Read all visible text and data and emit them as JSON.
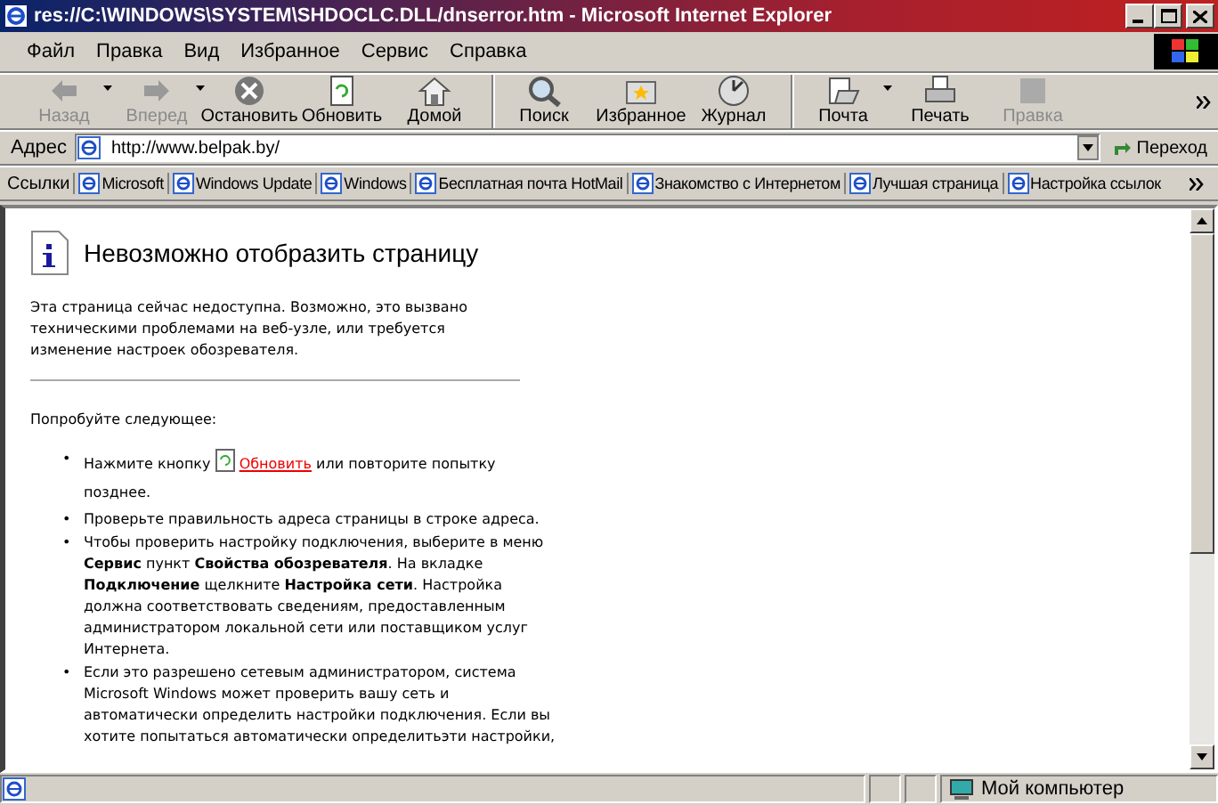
{
  "window": {
    "title": "res://C:\\WINDOWS\\SYSTEM\\SHDOCLC.DLL/dnserror.htm - Microsoft Internet Explorer"
  },
  "menu": [
    "Файл",
    "Правка",
    "Вид",
    "Избранное",
    "Сервис",
    "Справка"
  ],
  "toolbar": [
    {
      "label": "Назад",
      "disabled": true,
      "dropdown": true,
      "separator_before": false
    },
    {
      "label": "Вперед",
      "disabled": true,
      "dropdown": true,
      "separator_before": false
    },
    {
      "label": "Остановить",
      "disabled": false,
      "dropdown": false,
      "separator_before": false
    },
    {
      "label": "Обновить",
      "disabled": false,
      "dropdown": false,
      "separator_before": false
    },
    {
      "label": "Домой",
      "disabled": false,
      "dropdown": false,
      "separator_before": false
    },
    {
      "label": "Поиск",
      "disabled": false,
      "dropdown": false,
      "separator_before": true
    },
    {
      "label": "Избранное",
      "disabled": false,
      "dropdown": false,
      "separator_before": false
    },
    {
      "label": "Журнал",
      "disabled": false,
      "dropdown": false,
      "separator_before": false
    },
    {
      "label": "Почта",
      "disabled": false,
      "dropdown": true,
      "separator_before": true
    },
    {
      "label": "Печать",
      "disabled": false,
      "dropdown": false,
      "separator_before": false
    },
    {
      "label": "Правка",
      "disabled": true,
      "dropdown": false,
      "separator_before": false
    }
  ],
  "address": {
    "label": "Адрес",
    "value": "http://www.belpak.by/",
    "go": "Переход"
  },
  "links": {
    "label": "Ссылки",
    "items": [
      "Microsoft",
      "Windows Update",
      "Windows",
      "Бесплатная почта HotMail",
      "Знакомство с Интернетом",
      "Лучшая страница",
      "Настройка ссылок"
    ]
  },
  "page": {
    "heading": "Невозможно отобразить страницу",
    "intro": "Эта страница сейчас недоступна. Возможно, это вызвано техническими проблемами на веб-узле, или требуется изменение настроек обозревателя.",
    "try": "Попробуйте следующее:",
    "bullets": [
      {
        "kind": "refresh",
        "marker": "•",
        "before": "Нажмите кнопку",
        "link": "Обновить",
        "after": "или повторите попытку позднее."
      },
      {
        "kind": "text",
        "marker": "•",
        "text": "Проверьте правильность адреса страницы в строке адреса."
      },
      {
        "kind": "text",
        "marker": "•",
        "text": "Чтобы проверить настройку подключения, выберите в меню **Сервис** пункт **Свойства обозревателя**. На вкладке **Подключение** щелкните **Настройка сети**. Настройка должна соответствовать сведениям, предоставленным администратором локальной сети или поставщиком услуг Интернета."
      },
      {
        "kind": "text",
        "marker": "•",
        "text": "Если это разрешено сетевым администратором, система Microsoft Windows может проверить вашу сеть и автоматически определить настройки подключения. Если вы хотите попытаться автоматически определитьэти настройки,"
      }
    ]
  },
  "status": {
    "zone": "Мой компьютер"
  }
}
